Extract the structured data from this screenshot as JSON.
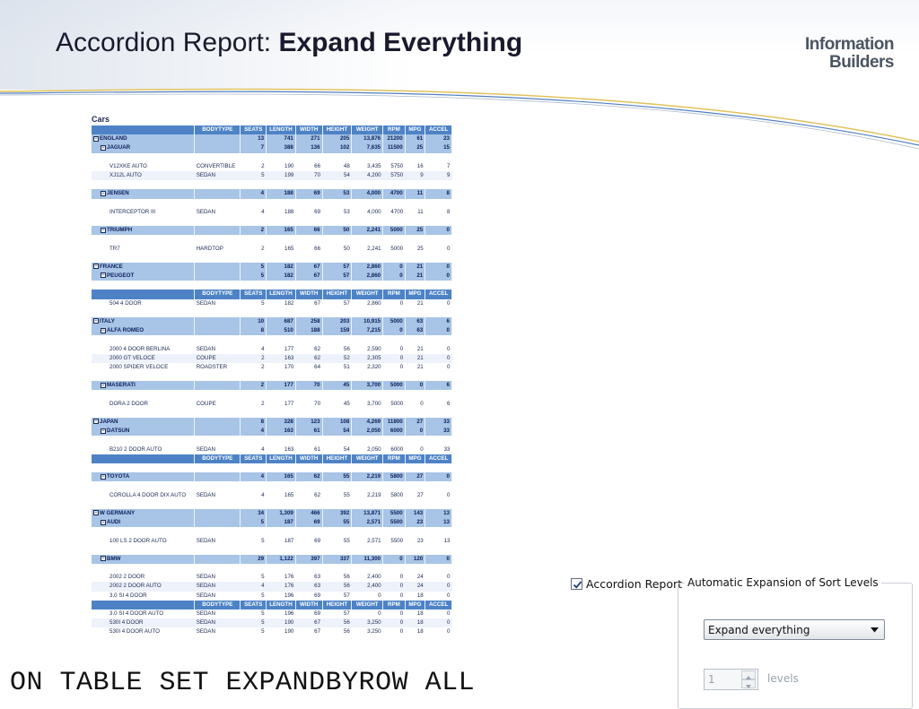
{
  "slide": {
    "title_prefix": "Accordion Report: ",
    "title_bold": "Expand Everything",
    "logo_line1": "Information",
    "logo_line2": "Builders",
    "code": "ON TABLE SET EXPANDBYROW ALL"
  },
  "report": {
    "title": "Cars",
    "columns": [
      "BODYTYPE",
      "SEATS",
      "LENGTH",
      "WIDTH",
      "HEIGHT",
      "WEIGHT",
      "RPM",
      "MPG",
      "ACCEL"
    ],
    "toggle_symbol": "⊟",
    "rows": [
      {
        "kind": "hdr"
      },
      {
        "kind": "grp",
        "level": 0,
        "label": "ENGLAND",
        "vals": [
          "",
          "13",
          "741",
          "271",
          "205",
          "13,876",
          "21200",
          "61",
          "23"
        ]
      },
      {
        "kind": "grp",
        "level": 1,
        "label": "JAGUAR",
        "vals": [
          "",
          "7",
          "388",
          "136",
          "102",
          "7,635",
          "11500",
          "25",
          "15"
        ]
      },
      {
        "kind": "spacer"
      },
      {
        "kind": "dat",
        "label": "V12XKE AUTO",
        "vals": [
          "CONVERTIBLE",
          "2",
          "190",
          "66",
          "48",
          "3,435",
          "5750",
          "16",
          "7"
        ]
      },
      {
        "kind": "dat",
        "alt": true,
        "label": "XJ12L AUTO",
        "vals": [
          "SEDAN",
          "5",
          "199",
          "70",
          "54",
          "4,200",
          "5750",
          "9",
          "9"
        ]
      },
      {
        "kind": "spacer"
      },
      {
        "kind": "grp",
        "level": 1,
        "label": "JENSEN",
        "vals": [
          "",
          "4",
          "188",
          "69",
          "53",
          "4,000",
          "4700",
          "11",
          "8"
        ]
      },
      {
        "kind": "spacer"
      },
      {
        "kind": "dat",
        "label": "INTERCEPTOR III",
        "vals": [
          "SEDAN",
          "4",
          "188",
          "69",
          "53",
          "4,000",
          "4700",
          "11",
          "8"
        ]
      },
      {
        "kind": "spacer"
      },
      {
        "kind": "grp",
        "level": 1,
        "label": "TRIUMPH",
        "vals": [
          "",
          "2",
          "165",
          "66",
          "50",
          "2,241",
          "5000",
          "25",
          "0"
        ]
      },
      {
        "kind": "spacer"
      },
      {
        "kind": "dat",
        "label": "TR7",
        "vals": [
          "HARDTOP",
          "2",
          "165",
          "66",
          "50",
          "2,241",
          "5000",
          "25",
          "0"
        ]
      },
      {
        "kind": "spacer"
      },
      {
        "kind": "grp",
        "level": 0,
        "label": "FRANCE",
        "vals": [
          "",
          "5",
          "182",
          "67",
          "57",
          "2,860",
          "0",
          "21",
          "0"
        ]
      },
      {
        "kind": "grp",
        "level": 1,
        "label": "PEUGEOT",
        "vals": [
          "",
          "5",
          "182",
          "67",
          "57",
          "2,860",
          "0",
          "21",
          "0"
        ]
      },
      {
        "kind": "spacer"
      },
      {
        "kind": "hdr"
      },
      {
        "kind": "dat",
        "label": "504 4 DOOR",
        "vals": [
          "SEDAN",
          "5",
          "182",
          "67",
          "57",
          "2,860",
          "0",
          "21",
          "0"
        ]
      },
      {
        "kind": "spacer"
      },
      {
        "kind": "grp",
        "level": 0,
        "label": "ITALY",
        "vals": [
          "",
          "10",
          "687",
          "258",
          "203",
          "10,915",
          "5000",
          "63",
          "6"
        ]
      },
      {
        "kind": "grp",
        "level": 1,
        "label": "ALFA ROMEO",
        "vals": [
          "",
          "8",
          "510",
          "188",
          "159",
          "7,215",
          "0",
          "63",
          "0"
        ]
      },
      {
        "kind": "spacer"
      },
      {
        "kind": "dat",
        "label": "2000 4 DOOR BERLINA",
        "vals": [
          "SEDAN",
          "4",
          "177",
          "62",
          "56",
          "2,590",
          "0",
          "21",
          "0"
        ]
      },
      {
        "kind": "dat",
        "alt": true,
        "label": "2000 GT VELOCE",
        "vals": [
          "COUPE",
          "2",
          "163",
          "62",
          "52",
          "2,305",
          "0",
          "21",
          "0"
        ]
      },
      {
        "kind": "dat",
        "label": "2000 SPIDER VELOCE",
        "vals": [
          "ROADSTER",
          "2",
          "170",
          "64",
          "51",
          "2,320",
          "0",
          "21",
          "0"
        ]
      },
      {
        "kind": "spacer"
      },
      {
        "kind": "grp",
        "level": 1,
        "label": "MASERATI",
        "vals": [
          "",
          "2",
          "177",
          "70",
          "45",
          "3,700",
          "5000",
          "0",
          "6"
        ]
      },
      {
        "kind": "spacer"
      },
      {
        "kind": "dat",
        "label": "DORA 2 DOOR",
        "vals": [
          "COUPE",
          "2",
          "177",
          "70",
          "45",
          "3,700",
          "5000",
          "0",
          "6"
        ]
      },
      {
        "kind": "spacer"
      },
      {
        "kind": "grp",
        "level": 0,
        "label": "JAPAN",
        "vals": [
          "",
          "8",
          "328",
          "123",
          "108",
          "4,269",
          "11800",
          "27",
          "33"
        ]
      },
      {
        "kind": "grp",
        "level": 1,
        "label": "DATSUN",
        "vals": [
          "",
          "4",
          "163",
          "61",
          "54",
          "2,050",
          "6000",
          "0",
          "33"
        ]
      },
      {
        "kind": "spacer"
      },
      {
        "kind": "dat",
        "label": "B210 2 DOOR AUTO",
        "vals": [
          "SEDAN",
          "4",
          "163",
          "61",
          "54",
          "2,050",
          "6000",
          "0",
          "33"
        ]
      },
      {
        "kind": "hdr"
      },
      {
        "kind": "spacer"
      },
      {
        "kind": "grp",
        "level": 1,
        "label": "TOYOTA",
        "vals": [
          "",
          "4",
          "165",
          "62",
          "55",
          "2,219",
          "5800",
          "27",
          "0"
        ]
      },
      {
        "kind": "spacer"
      },
      {
        "kind": "dat",
        "label": "COROLLA 4 DOOR DIX AUTO",
        "vals": [
          "SEDAN",
          "4",
          "165",
          "62",
          "55",
          "2,219",
          "5800",
          "27",
          "0"
        ]
      },
      {
        "kind": "spacer"
      },
      {
        "kind": "grp",
        "level": 0,
        "label": "W GERMANY",
        "vals": [
          "",
          "34",
          "1,309",
          "466",
          "392",
          "13,871",
          "5500",
          "143",
          "13"
        ]
      },
      {
        "kind": "grp",
        "level": 1,
        "label": "AUDI",
        "vals": [
          "",
          "5",
          "187",
          "69",
          "55",
          "2,571",
          "5500",
          "23",
          "13"
        ]
      },
      {
        "kind": "spacer"
      },
      {
        "kind": "dat",
        "label": "100 LS 2 DOOR AUTO",
        "vals": [
          "SEDAN",
          "5",
          "187",
          "69",
          "55",
          "2,571",
          "5500",
          "23",
          "13"
        ]
      },
      {
        "kind": "spacer"
      },
      {
        "kind": "grp",
        "level": 1,
        "label": "BMW",
        "vals": [
          "",
          "29",
          "1,122",
          "397",
          "337",
          "11,300",
          "0",
          "120",
          "0"
        ]
      },
      {
        "kind": "spacer"
      },
      {
        "kind": "dat",
        "label": "2002 2 DOOR",
        "vals": [
          "SEDAN",
          "5",
          "176",
          "63",
          "56",
          "2,400",
          "0",
          "24",
          "0"
        ]
      },
      {
        "kind": "dat",
        "alt": true,
        "label": "2002 2 DOOR AUTO",
        "vals": [
          "SEDAN",
          "4",
          "176",
          "63",
          "56",
          "2,400",
          "0",
          "24",
          "0"
        ]
      },
      {
        "kind": "dat",
        "label": "3.0 SI 4 DOOR",
        "vals": [
          "SEDAN",
          "5",
          "196",
          "69",
          "57",
          "0",
          "0",
          "18",
          "0"
        ]
      },
      {
        "kind": "hdr"
      },
      {
        "kind": "dat",
        "label": "3.0 SI 4 DOOR AUTO",
        "vals": [
          "SEDAN",
          "5",
          "196",
          "69",
          "57",
          "0",
          "0",
          "18",
          "0"
        ]
      },
      {
        "kind": "dat",
        "alt": true,
        "label": "530I 4 DOOR",
        "vals": [
          "SEDAN",
          "5",
          "190",
          "67",
          "56",
          "3,250",
          "0",
          "18",
          "0"
        ]
      },
      {
        "kind": "dat",
        "label": "530I 4 DOOR AUTO",
        "vals": [
          "SEDAN",
          "5",
          "190",
          "67",
          "56",
          "3,250",
          "0",
          "18",
          "0"
        ]
      }
    ]
  },
  "dialog": {
    "accordion_checkbox_label": "Accordion Report",
    "accordion_checked": true,
    "group_title": "Automatic Expansion of Sort Levels",
    "select_value": "Expand everything",
    "levels_value": "1",
    "levels_label": "levels"
  },
  "colors": {
    "header_blue": "#4d83c6",
    "group_blue": "#a8c4e6",
    "alt_row": "#eef2fb",
    "accent_line_gold": "#e0c25a",
    "accent_line_blue": "#4f7fc0"
  }
}
